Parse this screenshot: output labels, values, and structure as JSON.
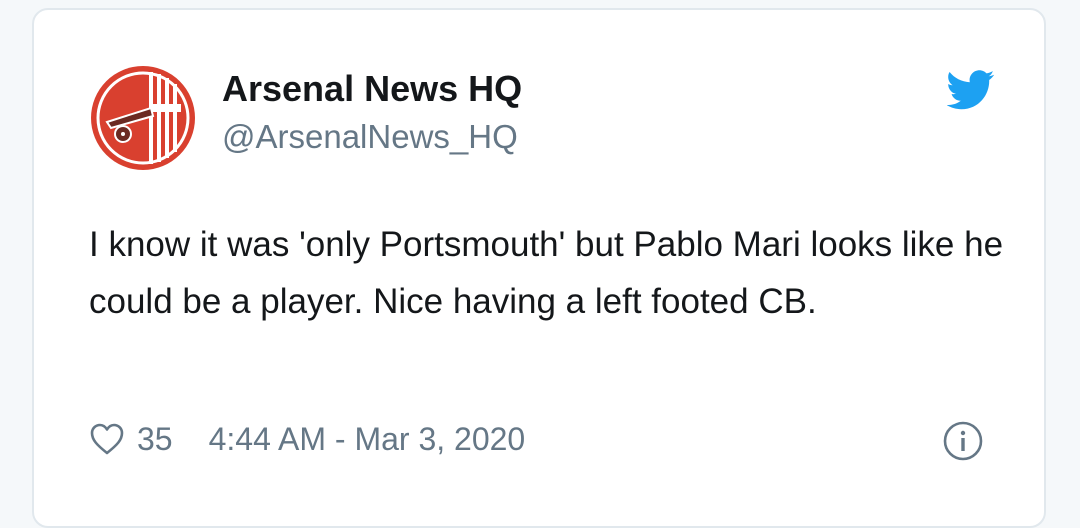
{
  "tweet": {
    "display_name": "Arsenal News HQ",
    "handle": "@ArsenalNews_HQ",
    "text": "I know it was 'only Portsmouth' but Pablo Mari looks like he could be a player. Nice having a left footed CB.",
    "like_count": "35",
    "timestamp": "4:44 AM - Mar 3, 2020"
  },
  "icons": {
    "avatar": "arsenal-cannon-logo",
    "platform": "twitter-bird-icon",
    "like": "heart-icon",
    "info": "info-icon"
  },
  "colors": {
    "avatar_red": "#d9402f",
    "twitter_blue": "#1da1f2",
    "text": "#14171a",
    "secondary_text": "#657786"
  }
}
